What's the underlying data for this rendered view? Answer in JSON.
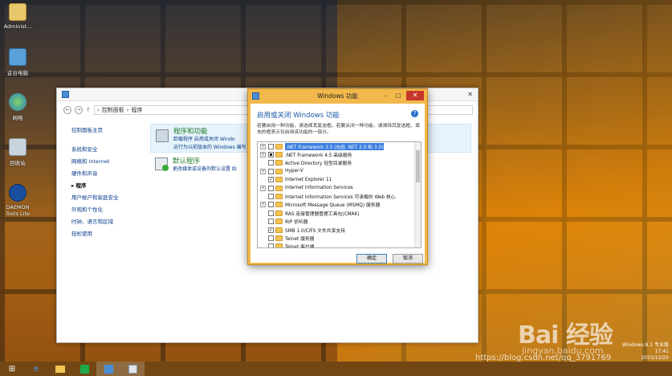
{
  "desktop": {
    "icons": [
      {
        "label": "Administ...",
        "icon": "user-folder-icon"
      },
      {
        "label": "这台电脑",
        "icon": "computer-icon"
      },
      {
        "label": "网络",
        "icon": "network-icon"
      },
      {
        "label": "回收站",
        "icon": "recycle-bin-icon"
      },
      {
        "label": "DAEMON Tools Lite",
        "icon": "daemon-tools-icon"
      }
    ]
  },
  "control_panel": {
    "breadcrumb": [
      "控制面板",
      "程序"
    ],
    "sidebar": {
      "home": "控制面板主页",
      "items": [
        "系统和安全",
        "网络和 Internet",
        "硬件和声音",
        "程序",
        "用户帐户和家庭安全",
        "外观和个性化",
        "时钟、语言和区域",
        "轻松使用"
      ],
      "current": "程序"
    },
    "programs_section": {
      "title": "程序和功能",
      "links_line1": "卸载程序    启用或关闭 Windo",
      "links_line2": "运行为以前版本的 Windows 编写"
    },
    "default_section": {
      "title": "默认程序",
      "links": "更改媒体或设备的默认设置    始"
    }
  },
  "features_dialog": {
    "window_title": "Windows 功能",
    "heading": "启用或关闭 Windows 功能",
    "description": "若要启用一种功能，请选择其复选框。若要关闭一种功能，请清除其复选框。填充的框表示仅启用该功能的一部分。",
    "features": [
      {
        "name": ".NET Framework 3.5 (包括 .NET 2.0 和 3.0)",
        "expandable": true,
        "state": "unchecked",
        "selected": true
      },
      {
        "name": ".NET Framework 4.5 高级服务",
        "expandable": true,
        "state": "partial",
        "selected": false
      },
      {
        "name": "Active Directory 轻型目录服务",
        "expandable": false,
        "state": "unchecked",
        "selected": false
      },
      {
        "name": "Hyper-V",
        "expandable": true,
        "state": "unchecked",
        "selected": false
      },
      {
        "name": "Internet Explorer 11",
        "expandable": false,
        "state": "checked",
        "selected": false
      },
      {
        "name": "Internet Information Services",
        "expandable": true,
        "state": "unchecked",
        "selected": false
      },
      {
        "name": "Internet Information Services 可承载的 Web 核心",
        "expandable": false,
        "state": "unchecked",
        "selected": false
      },
      {
        "name": "Microsoft Message Queue (MSMQ) 服务器",
        "expandable": true,
        "state": "unchecked",
        "selected": false
      },
      {
        "name": "RAS 连接管理器管理工具包(CMAK)",
        "expandable": false,
        "state": "unchecked",
        "selected": false
      },
      {
        "name": "RIP 侦听器",
        "expandable": false,
        "state": "unchecked",
        "selected": false
      },
      {
        "name": "SMB 1.0/CIFS 文件共享支持",
        "expandable": false,
        "state": "checked",
        "selected": false
      },
      {
        "name": "Telnet 服务器",
        "expandable": false,
        "state": "unchecked",
        "selected": false
      },
      {
        "name": "Telnet 客户端",
        "expandable": false,
        "state": "unchecked",
        "selected": false
      }
    ],
    "ok_label": "确定",
    "cancel_label": "取消"
  },
  "taskbar": {
    "items": [
      "start-icon",
      "ie-icon",
      "file-explorer-icon",
      "store-icon",
      "control-panel-icon",
      "features-icon"
    ]
  },
  "system": {
    "os_version": "Windows 8.1 专业版",
    "time": "17:41",
    "date": "2015/12/25"
  },
  "watermarks": {
    "baidu": "Bai 经验",
    "jingyan": "jingyan.baidu.com",
    "csdn": "https://blog.csdn.net/qq_3791769"
  }
}
